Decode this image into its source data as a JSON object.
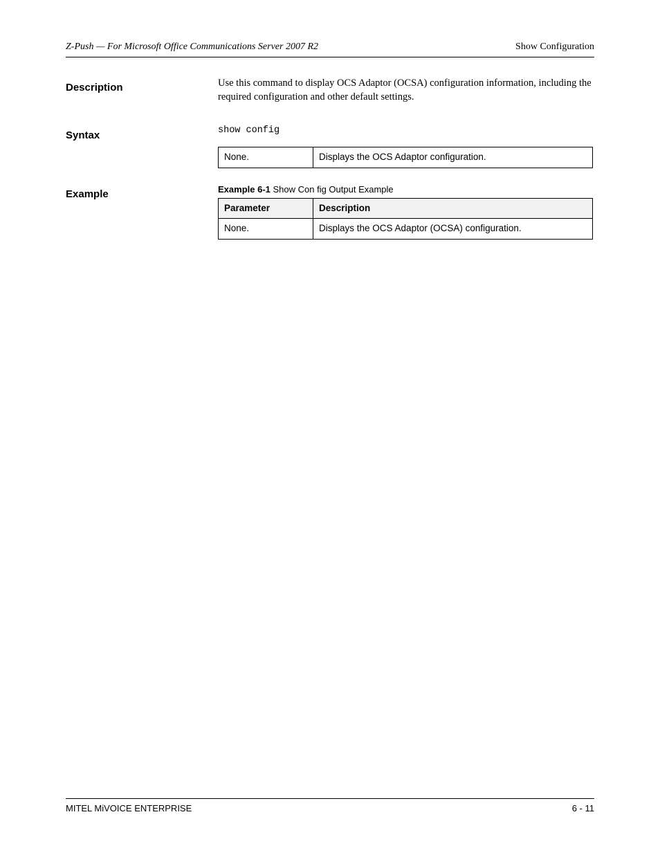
{
  "header": {
    "left": "Z-Push — For Microsoft Office Communications Server 2007 R2",
    "right": "Show Configuration"
  },
  "sections": {
    "description": {
      "label": "Description",
      "text": "Use this command to display OCS Adaptor (OCSA) configuration information, including the required configuration and other default settings."
    },
    "syntax": {
      "label": "Syntax",
      "code": "show config",
      "params_table": {
        "rows": [
          {
            "param": "None.",
            "desc": "Displays the OCS Adaptor configuration."
          }
        ]
      }
    },
    "example": {
      "label": "Example",
      "title": "Example 6-1",
      "subtitle": "Show Con fig Output Example",
      "table": {
        "headers": [
          "Parameter",
          "Description"
        ],
        "rows": [
          {
            "param": "None.",
            "desc": "Displays the OCS Adaptor (OCSA) configuration."
          }
        ]
      }
    }
  },
  "footer": {
    "left": "MITEL MiVOICE ENTERPRISE",
    "right": "6 - 11"
  }
}
